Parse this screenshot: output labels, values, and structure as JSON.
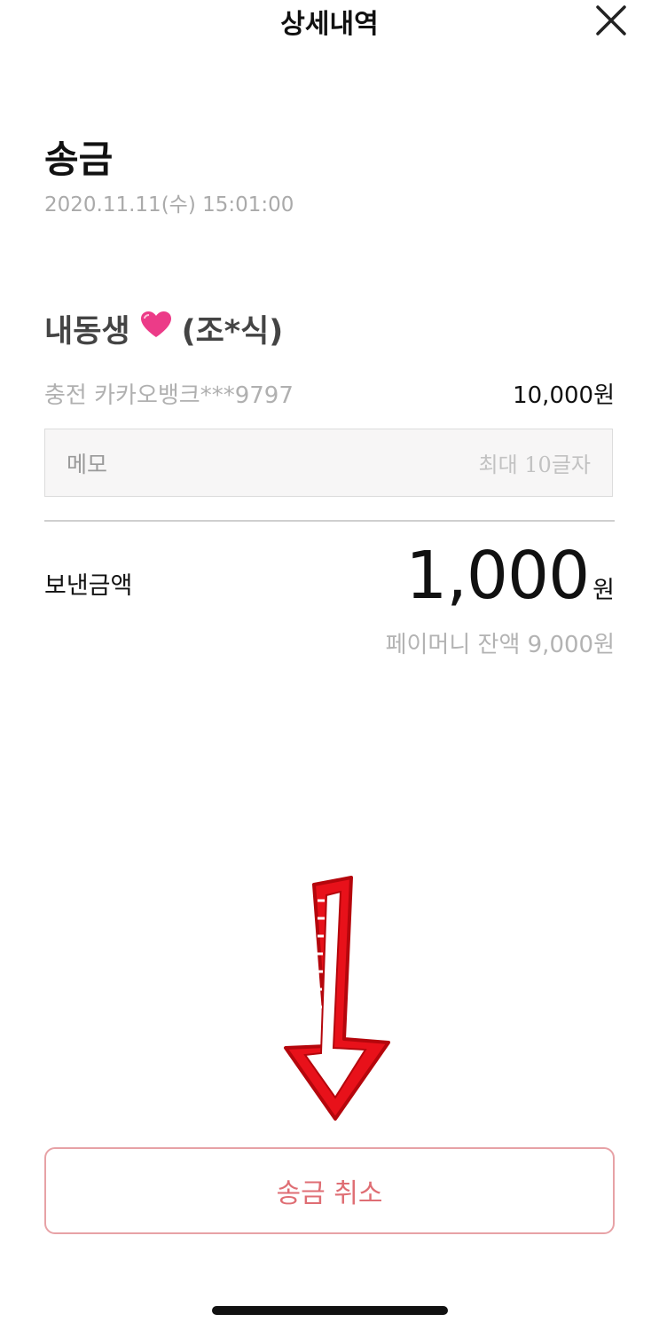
{
  "header": {
    "title": "상세내역"
  },
  "transaction": {
    "type": "송금",
    "datetime": "2020.11.11(수) 15:01:00",
    "recipient_name": "내동생",
    "recipient_masked": "(조*식)",
    "source": "충전 카카오뱅크***9797",
    "source_amount": "10,000원"
  },
  "memo": {
    "label": "메모",
    "hint": "최대 10글자"
  },
  "sent": {
    "label": "보낸금액",
    "amount": "1,000",
    "unit": "원",
    "balance": "페이머니 잔액 9,000원"
  },
  "actions": {
    "cancel_label": "송금 취소"
  },
  "icons": {
    "close": "close-icon",
    "heart": "heart-icon",
    "arrow": "arrow-down-icon"
  },
  "colors": {
    "accent": "#df6e74",
    "arrow": "#e8111a",
    "heart": "#ec3b88"
  }
}
